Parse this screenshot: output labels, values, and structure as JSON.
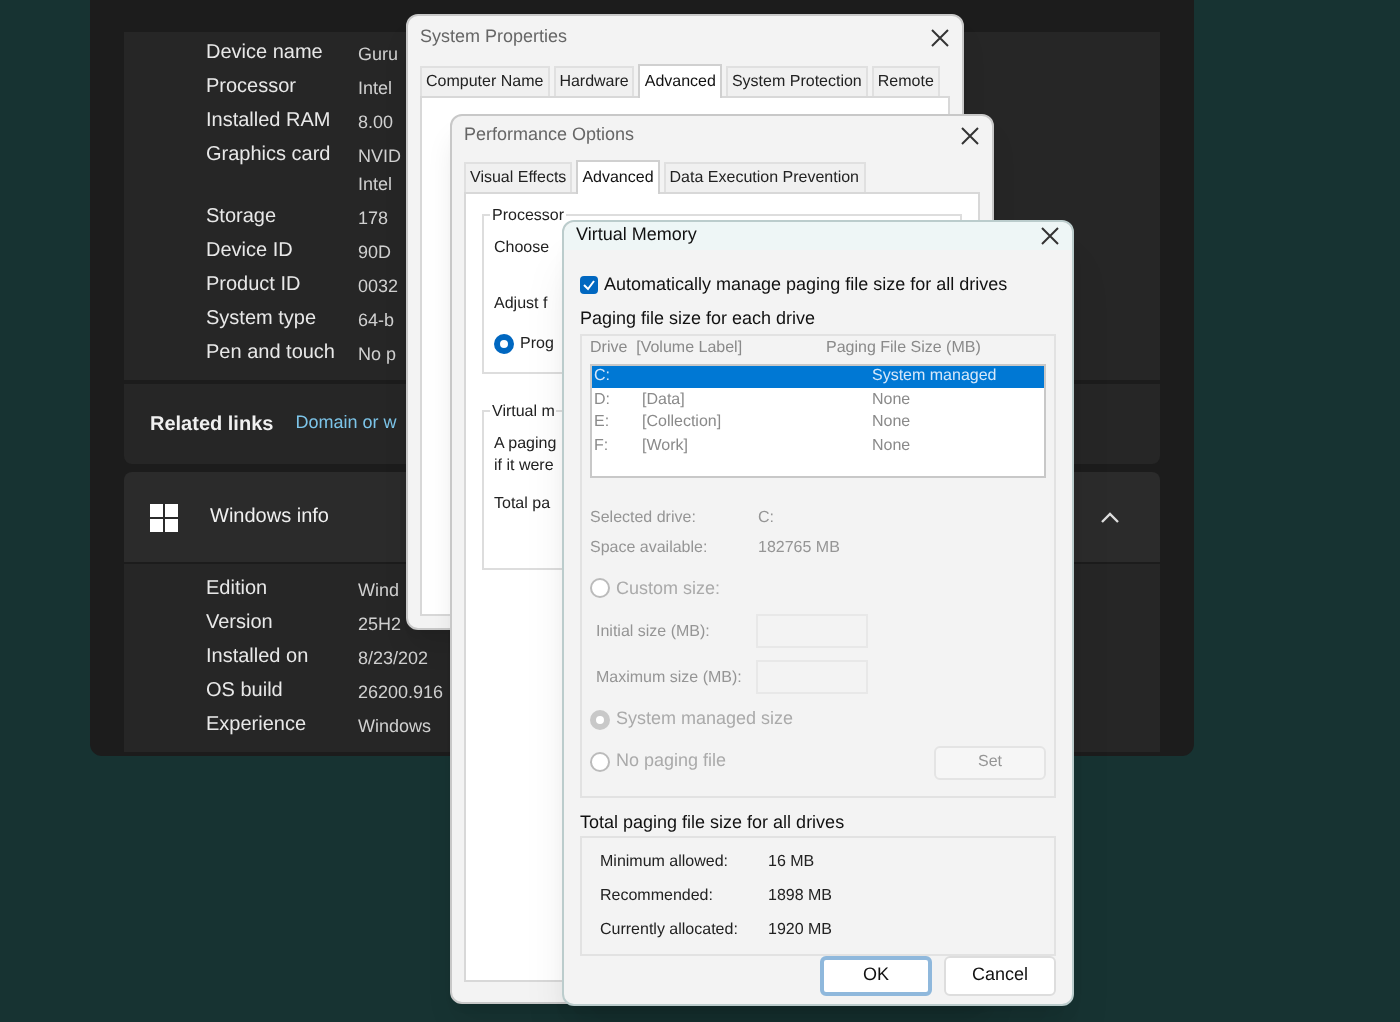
{
  "settings": {
    "specs": [
      {
        "label": "Device name",
        "values": [
          "Guru"
        ]
      },
      {
        "label": "Processor",
        "values": [
          "Intel"
        ]
      },
      {
        "label": "Installed RAM",
        "values": [
          "8.00"
        ]
      },
      {
        "label": "Graphics card",
        "values": [
          "NVID",
          "Intel"
        ]
      },
      {
        "label": "Storage",
        "values": [
          "178"
        ]
      },
      {
        "label": "Device ID",
        "values": [
          "90D"
        ]
      },
      {
        "label": "Product ID",
        "values": [
          "0032"
        ]
      },
      {
        "label": "System type",
        "values": [
          "64-b"
        ]
      },
      {
        "label": "Pen and touch",
        "values": [
          "No p"
        ]
      }
    ],
    "related_links": {
      "label": "Related links",
      "link": "Domain or w"
    },
    "windows_info": {
      "title": "Windows info",
      "expanded": true,
      "specs": [
        {
          "label": "Edition",
          "values": [
            "Wind"
          ]
        },
        {
          "label": "Version",
          "values": [
            "25H2"
          ]
        },
        {
          "label": "Installed on",
          "values": [
            "8/23/202"
          ]
        },
        {
          "label": "OS build",
          "values": [
            "26200.916"
          ]
        },
        {
          "label": "Experience",
          "values": [
            "Windows"
          ]
        }
      ]
    }
  },
  "system_properties": {
    "title": "System Properties",
    "tabs": [
      {
        "label": "Computer Name",
        "selected": false
      },
      {
        "label": "Hardware",
        "selected": false
      },
      {
        "label": "Advanced",
        "selected": true
      },
      {
        "label": "System Protection",
        "selected": false
      },
      {
        "label": "Remote",
        "selected": false
      }
    ]
  },
  "performance_options": {
    "title": "Performance Options",
    "tabs": [
      {
        "label": "Visual Effects",
        "selected": false
      },
      {
        "label": "Advanced",
        "selected": true
      },
      {
        "label": "Data Execution Prevention",
        "selected": false
      }
    ],
    "processor_group": {
      "title": "Processor",
      "lines": [
        "Choose",
        "Adjust f"
      ],
      "radio": {
        "label": "Prog",
        "selected": true
      }
    },
    "virtual_memory_group": {
      "title": "Virtual m",
      "lines": [
        "A paging",
        "if it were"
      ],
      "total": "Total pa"
    }
  },
  "virtual_memory": {
    "title": "Virtual Memory",
    "auto_manage": {
      "label": "Automatically manage paging file size for all drives",
      "checked": true
    },
    "drive_group": {
      "title": "Paging file size for each drive",
      "disabled": true,
      "columns": [
        "Drive  [Volume Label]",
        "Paging File Size (MB)"
      ],
      "drives": [
        {
          "drive": "C:",
          "size": "System managed",
          "selected": true
        },
        {
          "drive": "D:",
          "label": "[Data]",
          "size": "None",
          "selected": false
        },
        {
          "drive": "E:",
          "label": "[Collection]",
          "size": "None",
          "selected": false
        },
        {
          "drive": "F:",
          "label": "[Work]",
          "size": "None",
          "selected": false
        }
      ],
      "info": [
        {
          "label": "Selected drive:",
          "value": "C:"
        },
        {
          "label": "Space available:",
          "value": "182765 MB"
        }
      ],
      "options": [
        {
          "kind": "radio",
          "label": "Custom size:",
          "selected": false
        },
        {
          "kind": "field",
          "label": "Initial size (MB):"
        },
        {
          "kind": "field",
          "label": "Maximum size (MB):"
        },
        {
          "kind": "radio",
          "label": "System managed size",
          "selected": true
        },
        {
          "kind": "radio",
          "label": "No paging file",
          "selected": false
        }
      ],
      "set_button": "Set"
    },
    "totals": {
      "title": "Total paging file size for all drives",
      "rows": [
        {
          "label": "Minimum allowed:",
          "value": "16 MB"
        },
        {
          "label": "Recommended:",
          "value": "1898 MB"
        },
        {
          "label": "Currently allocated:",
          "value": "1920 MB"
        }
      ]
    },
    "buttons": [
      {
        "label": "OK",
        "default": true
      },
      {
        "label": "Cancel",
        "default": false
      }
    ]
  }
}
